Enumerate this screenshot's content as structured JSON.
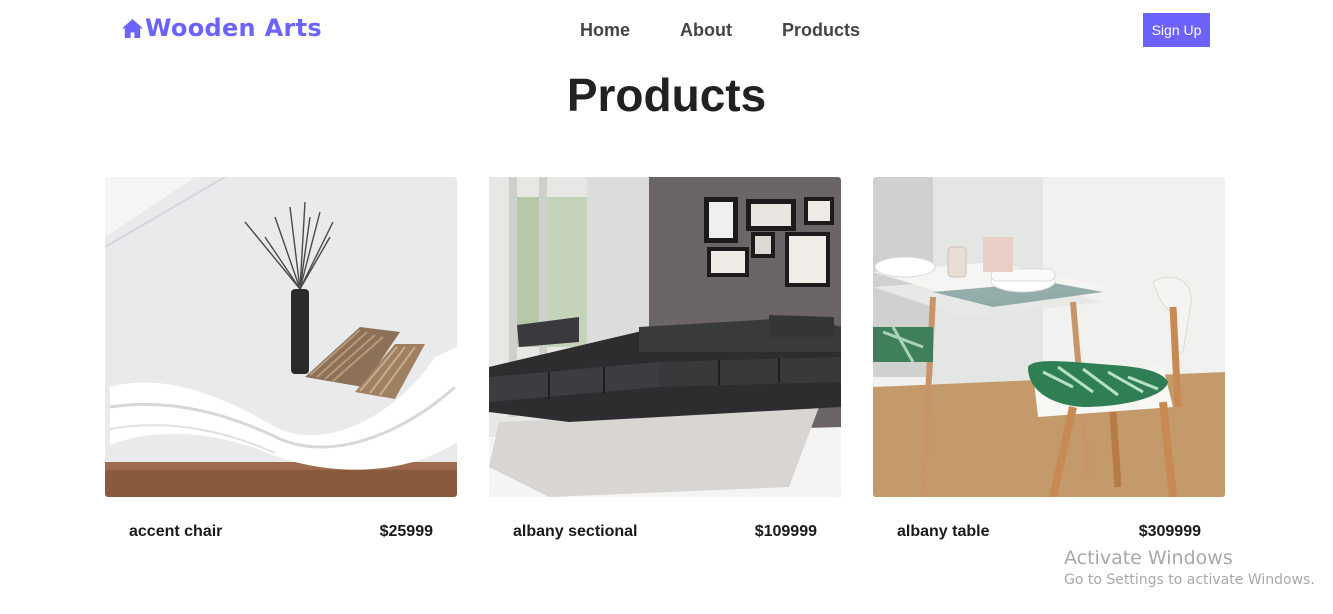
{
  "brand": {
    "name": "Wooden Arts",
    "icon": "home-icon",
    "color": "#6c63ff"
  },
  "nav": {
    "items": [
      "Home",
      "About",
      "Products"
    ]
  },
  "signup": {
    "label": "Sign Up"
  },
  "page": {
    "title": "Products"
  },
  "products": [
    {
      "name": "accent chair",
      "price": "$25999"
    },
    {
      "name": "albany sectional",
      "price": "$109999"
    },
    {
      "name": "albany table",
      "price": "$309999"
    }
  ],
  "watermark": {
    "line1": "Activate Windows",
    "line2": "Go to Settings to activate Windows."
  }
}
